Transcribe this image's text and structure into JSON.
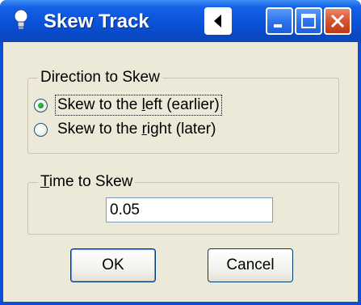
{
  "window": {
    "title": "Skew Track",
    "controls": {
      "back_icon": "triangle-left-icon",
      "minimize_icon": "minimize-icon",
      "maximize_icon": "maximize-icon",
      "close_icon": "close-icon"
    }
  },
  "direction_group": {
    "legend": "Direction to Skew",
    "options": [
      {
        "prefix": "Skew to the ",
        "hotkey": "l",
        "suffix": "eft (earlier)",
        "selected": true
      },
      {
        "prefix": "Skew to the ",
        "hotkey": "r",
        "suffix": "ight (later)",
        "selected": false
      }
    ]
  },
  "time_group": {
    "legend_hotkey": "T",
    "legend_rest": "ime to Skew",
    "value": "0.05"
  },
  "buttons": {
    "ok_label": "OK",
    "cancel_label": "Cancel"
  },
  "colors": {
    "titlebar": "#0a52d8",
    "dialog_bg": "#ece9d8",
    "close_button": "#d6532e",
    "radio_dot": "#1f8a2e"
  }
}
